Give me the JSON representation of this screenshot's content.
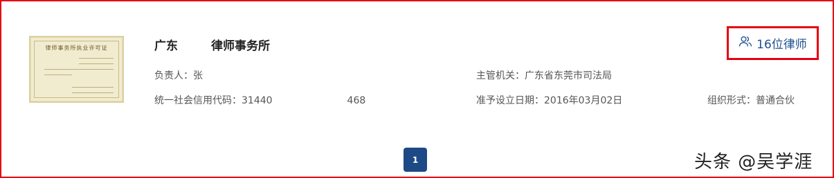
{
  "firm": {
    "name": "广东",
    "name_suffix": "律师事务所",
    "license_image_title": "律师事务所执业许可证"
  },
  "fields": {
    "responsible_label": "负责人：",
    "responsible_value": "张",
    "authority_label": "主管机关：",
    "authority_value": "广东省东莞市司法局",
    "credit_code_label": "统一社会信用代码：",
    "credit_code_value": "31440",
    "credit_code_tail": "468",
    "approval_date_label": "准予设立日期：",
    "approval_date_value": "2016年03月02日",
    "org_form_label": "组织形式：",
    "org_form_value": "普通合伙"
  },
  "lawyers": {
    "label": "16位律师",
    "icon": "users-icon",
    "color": "#1c4f8f"
  },
  "pagination": {
    "current_page": "1"
  },
  "watermark": {
    "text": "头条 @吴学涯"
  },
  "colors": {
    "highlight_border": "#e60012",
    "pager_bg": "#1d4a86"
  }
}
